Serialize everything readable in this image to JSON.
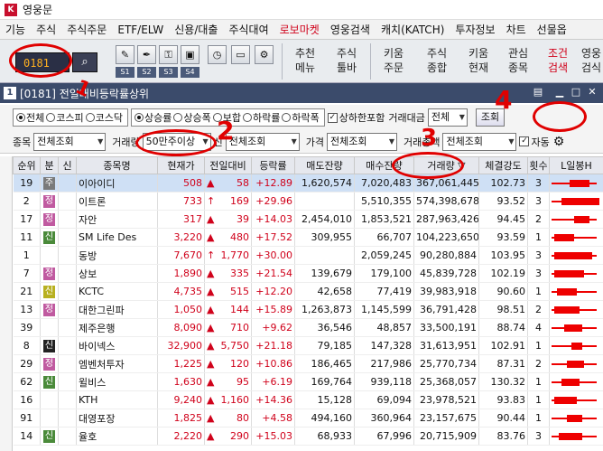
{
  "app": {
    "title": "영웅문",
    "icon_color": "#c8102e"
  },
  "menu": [
    "기능",
    "주식",
    "주식주문",
    "ETF/ELW",
    "신용/대출",
    "주식대여",
    "로보마켓",
    "영웅검색",
    "캐치(KATCH)",
    "투자정보",
    "차트",
    "선물옵"
  ],
  "toolbar": {
    "screen_code": "0181",
    "s_labels": [
      "S1",
      "S2",
      "S3",
      "S4"
    ],
    "menus": [
      {
        "l1": "추천",
        "l2": "메뉴"
      },
      {
        "l1": "주식",
        "l2": "툴바"
      },
      {
        "l1": "키움",
        "l2": "주문"
      },
      {
        "l1": "주식",
        "l2": "종합"
      },
      {
        "l1": "키움",
        "l2": "현재"
      },
      {
        "l1": "관심",
        "l2": "종목"
      },
      {
        "l1": "조건",
        "l2": "검색"
      },
      {
        "l1": "영웅",
        "l2": "검식"
      }
    ]
  },
  "window": {
    "num": "1",
    "title": "[0181] 전일대비등락률상위"
  },
  "filters": {
    "market_all": "전체",
    "kospi": "코스피",
    "kosdaq": "코스닥",
    "sort_rise_rate": "상승률",
    "sort_rise_amt": "상승폭",
    "sort_flat": "보합",
    "sort_fall_rate": "하락률",
    "sort_fall_amt": "하락폭",
    "limit_incl": "상하한포함",
    "value_label": "거래대금",
    "value_sel": "전체",
    "query_btn": "조회",
    "stock_label": "종목",
    "stock_sel": "전체조회",
    "volume_label": "거래량",
    "volume_sel": "50만주이상",
    "credit_sel": "전체조회",
    "price_label": "가격",
    "price_sel": "전체조회",
    "total_label": "거래총액",
    "total_sel": "전체조회",
    "auto_label": "자동"
  },
  "annotations": {
    "n1": "1",
    "n2": "2",
    "n3": "3",
    "n4": "4"
  },
  "columns": [
    "순위",
    "분",
    "신",
    "종목명",
    "현재가",
    "전일대비",
    "등락률",
    "매도잔량",
    "매수잔량",
    "거래량 ▽",
    "체결강도",
    "횟수",
    "L일봉H"
  ],
  "rows": [
    {
      "rank": "19",
      "b": "주",
      "bc": "b-ju",
      "s": "",
      "sc": "",
      "name": "이아이디",
      "price": "508",
      "arrow": "▲",
      "chg": "58",
      "rate": "+12.89",
      "ask": "1,620,574",
      "bid": "7,020,483",
      "vol": "367,061,445",
      "str": "102.73",
      "cnt": "3",
      "bar": [
        0.35,
        0.4
      ],
      "selected": true
    },
    {
      "rank": "2",
      "b": "정",
      "bc": "b-jeong",
      "s": "",
      "sc": "",
      "name": "이트론",
      "price": "733",
      "arrow": "↑",
      "chg": "169",
      "rate": "+29.96",
      "ask": "",
      "bid": "5,510,355",
      "vol": "574,398,678",
      "str": "93.52",
      "cnt": "3",
      "bar": [
        0.2,
        0.75
      ],
      "selected": false
    },
    {
      "rank": "17",
      "b": "정",
      "bc": "b-jeong",
      "s": "",
      "sc": "",
      "name": "자안",
      "price": "317",
      "arrow": "▲",
      "chg": "39",
      "rate": "+14.03",
      "ask": "2,454,010",
      "bid": "1,853,521",
      "vol": "287,963,426",
      "str": "94.45",
      "cnt": "2",
      "bar": [
        0.45,
        0.3
      ],
      "selected": false
    },
    {
      "rank": "11",
      "b": "신",
      "bc": "b-sin",
      "s": "",
      "sc": "",
      "name": "SM Life Des",
      "price": "3,220",
      "arrow": "▲",
      "chg": "480",
      "rate": "+17.52",
      "ask": "309,955",
      "bid": "66,707",
      "vol": "104,223,650",
      "str": "93.59",
      "cnt": "1",
      "bar": [
        0.05,
        0.4
      ],
      "selected": false
    },
    {
      "rank": "1",
      "b": "",
      "bc": "",
      "s": "",
      "sc": "",
      "name": "동방",
      "price": "7,670",
      "arrow": "↑",
      "chg": "1,770",
      "rate": "+30.00",
      "ask": "",
      "bid": "2,059,245",
      "vol": "90,280,884",
      "str": "103.95",
      "cnt": "3",
      "bar": [
        0.05,
        0.75
      ],
      "selected": false
    },
    {
      "rank": "7",
      "b": "정",
      "bc": "b-jeong",
      "s": "",
      "sc": "",
      "name": "상보",
      "price": "1,890",
      "arrow": "▲",
      "chg": "335",
      "rate": "+21.54",
      "ask": "139,679",
      "bid": "179,100",
      "vol": "45,839,728",
      "str": "102.19",
      "cnt": "3",
      "bar": [
        0.05,
        0.6
      ],
      "selected": false
    },
    {
      "rank": "21",
      "b": "신",
      "bc": "b-sin-y",
      "s": "",
      "sc": "",
      "name": "KCTC",
      "price": "4,735",
      "arrow": "▲",
      "chg": "515",
      "rate": "+12.20",
      "ask": "42,658",
      "bid": "77,419",
      "vol": "39,983,918",
      "str": "90.60",
      "cnt": "1",
      "bar": [
        0.1,
        0.4
      ],
      "selected": false
    },
    {
      "rank": "13",
      "b": "정",
      "bc": "b-jeong",
      "s": "",
      "sc": "",
      "name": "대한그린파",
      "price": "1,050",
      "arrow": "▲",
      "chg": "144",
      "rate": "+15.89",
      "ask": "1,263,873",
      "bid": "1,145,599",
      "vol": "36,791,428",
      "str": "98.51",
      "cnt": "2",
      "bar": [
        0.05,
        0.5
      ],
      "selected": false
    },
    {
      "rank": "39",
      "b": "",
      "bc": "",
      "s": "",
      "sc": "",
      "name": "제주은행",
      "price": "8,090",
      "arrow": "▲",
      "chg": "710",
      "rate": "+9.62",
      "ask": "36,546",
      "bid": "48,857",
      "vol": "33,500,191",
      "str": "88.74",
      "cnt": "4",
      "bar": [
        0.25,
        0.35
      ],
      "selected": false
    },
    {
      "rank": "8",
      "b": "신",
      "bc": "b-sin-dark",
      "s": "",
      "sc": "",
      "name": "바이넥스",
      "price": "32,900",
      "arrow": "▲",
      "chg": "5,750",
      "rate": "+21.18",
      "ask": "79,185",
      "bid": "147,328",
      "vol": "31,613,951",
      "str": "102.91",
      "cnt": "1",
      "bar": [
        0.4,
        0.2
      ],
      "selected": false
    },
    {
      "rank": "29",
      "b": "정",
      "bc": "b-jeong",
      "s": "",
      "sc": "",
      "name": "엠벤처투자",
      "price": "1,225",
      "arrow": "▲",
      "chg": "120",
      "rate": "+10.86",
      "ask": "186,465",
      "bid": "217,986",
      "vol": "25,770,734",
      "str": "87.31",
      "cnt": "2",
      "bar": [
        0.3,
        0.35
      ],
      "selected": false
    },
    {
      "rank": "62",
      "b": "신",
      "bc": "b-sin",
      "s": "",
      "sc": "",
      "name": "윌비스",
      "price": "1,630",
      "arrow": "▲",
      "chg": "95",
      "rate": "+6.19",
      "ask": "169,764",
      "bid": "939,118",
      "vol": "25,368,057",
      "str": "130.32",
      "cnt": "1",
      "bar": [
        0.2,
        0.35
      ],
      "selected": false
    },
    {
      "rank": "16",
      "b": "",
      "bc": "",
      "s": "",
      "sc": "",
      "name": "KTH",
      "price": "9,240",
      "arrow": "▲",
      "chg": "1,160",
      "rate": "+14.36",
      "ask": "15,128",
      "bid": "69,094",
      "vol": "23,978,521",
      "str": "93.83",
      "cnt": "1",
      "bar": [
        0.05,
        0.45
      ],
      "selected": false
    },
    {
      "rank": "91",
      "b": "",
      "bc": "",
      "s": "",
      "sc": "",
      "name": "대영포장",
      "price": "1,825",
      "arrow": "▲",
      "chg": "80",
      "rate": "+4.58",
      "ask": "494,160",
      "bid": "360,964",
      "vol": "23,157,675",
      "str": "90.44",
      "cnt": "1",
      "bar": [
        0.3,
        0.3
      ],
      "selected": false
    },
    {
      "rank": "14",
      "b": "신",
      "bc": "b-sin",
      "s": "",
      "sc": "",
      "name": "율호",
      "price": "2,220",
      "arrow": "▲",
      "chg": "290",
      "rate": "+15.03",
      "ask": "68,933",
      "bid": "67,996",
      "vol": "20,715,909",
      "str": "83.76",
      "cnt": "3",
      "bar": [
        0.15,
        0.45
      ],
      "selected": false
    }
  ]
}
